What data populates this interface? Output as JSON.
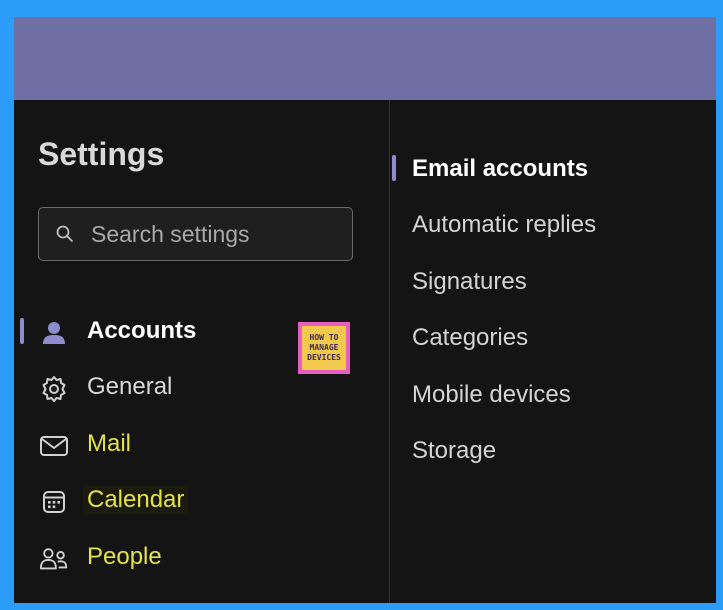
{
  "settings": {
    "title": "Settings",
    "search": {
      "placeholder": "Search settings",
      "value": ""
    }
  },
  "nav": {
    "items": [
      {
        "label": "Accounts",
        "icon": "person-icon",
        "selected": true
      },
      {
        "label": "General",
        "icon": "gear-icon"
      },
      {
        "label": "Mail",
        "icon": "mail-icon"
      },
      {
        "label": "Calendar",
        "icon": "calendar-icon"
      },
      {
        "label": "People",
        "icon": "people-icon"
      }
    ]
  },
  "accounts_menu": {
    "items": [
      {
        "label": "Email accounts",
        "selected": true
      },
      {
        "label": "Automatic replies"
      },
      {
        "label": "Signatures"
      },
      {
        "label": "Categories"
      },
      {
        "label": "Mobile devices"
      },
      {
        "label": "Storage"
      }
    ]
  },
  "watermark": {
    "line1": "HOW TO",
    "line2": "MANAGE",
    "line3": "DEVICES"
  },
  "colors": {
    "header": "#6f6fa6",
    "background": "#141414",
    "accent": "#8c8ccf",
    "highlight_text": "#e4e24c",
    "border": "#2b9cf7"
  }
}
